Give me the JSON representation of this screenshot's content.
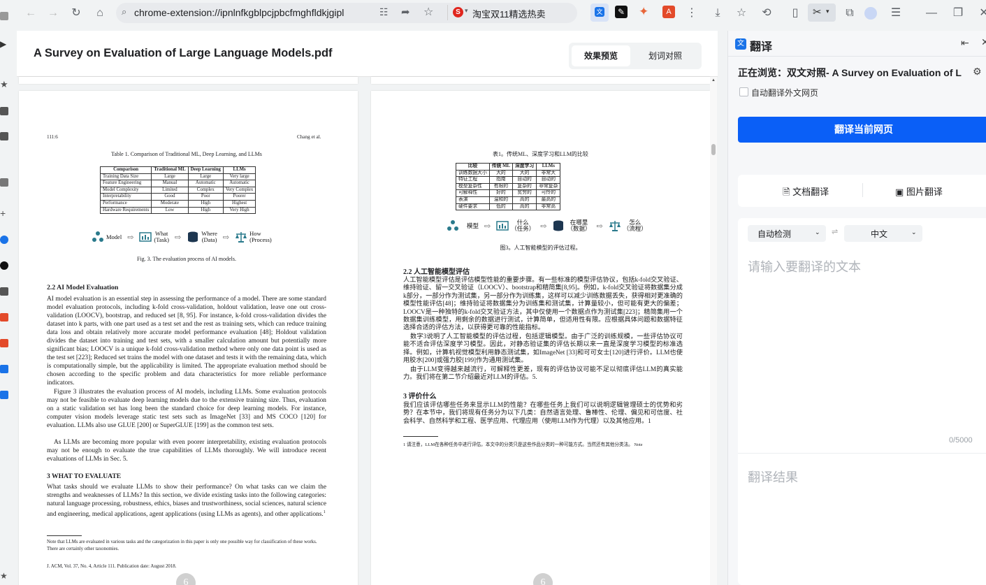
{
  "browser": {
    "url": "chrome-extension://ipnlnfkgblpcjpbcfmghfldkjgipl",
    "bookmark_text": "淘宝双11精选热卖",
    "bookmark_badge": "S"
  },
  "viewer": {
    "title": "A Survey on Evaluation of Large Language Models.pdf",
    "modes": [
      "效果预览",
      "划词对照"
    ],
    "active_mode": "效果预览"
  },
  "page_en": {
    "running_left": "111:6",
    "running_right": "Chang et al.",
    "table_caption": "Table 1.  Comparison of Traditional ML, Deep Learning, and LLMs",
    "table_headers": [
      "Comparison",
      "Traditional ML",
      "Deep Learning",
      "LLMs"
    ],
    "table_rows": [
      [
        "Training Data Size",
        "Large",
        "Large",
        "Very large"
      ],
      [
        "Feature Engineering",
        "Manual",
        "Automatic",
        "Automatic"
      ],
      [
        "Model Complexity",
        "Limited",
        "Complex",
        "Very Complex"
      ],
      [
        "Interpretability",
        "Good",
        "Poor",
        "Poorer"
      ],
      [
        "Performance",
        "Moderate",
        "High",
        "Highest"
      ],
      [
        "Hardware Requirements",
        "Low",
        "High",
        "Very High"
      ]
    ],
    "flow": {
      "model": "Model",
      "what": "What",
      "what_sub": "(Task)",
      "where": "Where",
      "where_sub": "(Data)",
      "how": "How",
      "how_sub": "(Process)"
    },
    "fig_caption": "Fig. 3.  The evaluation process of AI models.",
    "sec22_title": "2.2    AI Model Evaluation",
    "sec22_p1": "AI model evaluation is an essential step in assessing the performance of a model. There are some standard model evaluation protocols, including k-fold cross-validation, holdout validation, leave one out cross-validation (LOOCV), bootstrap, and reduced set [8, 95]. For instance, k-fold cross-validation divides the dataset into k parts, with one part used as a test set and the rest as training sets, which can reduce training data loss and obtain relatively more accurate model performance evaluation [48]; Holdout validation divides the dataset into training and test sets, with a smaller calculation amount but potentially more significant bias; LOOCV is a unique k-fold cross-validation method where only one data point is used as the test set [223]; Reduced set trains the model with one dataset and tests it with the remaining data, which is computationally simple, but the applicability is limited. The appropriate evaluation method should be chosen according to the specific problem and data characteristics for more reliable performance indicators.",
    "sec22_p2": "Figure 3 illustrates the evaluation process of AI models, including LLMs. Some evaluation protocols may not be feasible to evaluate deep learning models due to the extensive training size. Thus, evaluation on a static validation set has long been the standard choice for deep learning models. For instance, computer vision models leverage static test sets such as ImageNet [33] and MS COCO [120] for evaluation. LLMs also use GLUE [200] or SuperGLUE [199] as the common test sets.",
    "sec22_p3": "As LLMs are becoming more popular with even poorer interpretability, existing evaluation protocols may not be enough to evaluate the true capabilities of LLMs thoroughly. We will introduce recent evaluations of LLMs in Sec. 5.",
    "sec3_title": "3    WHAT TO EVALUATE",
    "sec3_p": "What tasks should we evaluate LLMs to show their performance? On what tasks can we claim the strengths and weaknesses of LLMs? In this section, we divide existing tasks into the following categories: natural language processing, robustness, ethics, biases and trustworthiness, social sciences, natural science and engineering, medical applications, agent applications (using LLMs as agents), and other applications.",
    "footnote_mark": "1",
    "footnote": "Note that LLMs are evaluated in various tasks and the categorization in this paper is only one possible way for classification of these works. There are certainly other taxonomies.",
    "journal": "J. ACM, Vol. 37, No. 4, Article 111. Publication date: August 2018.",
    "page_number": "6"
  },
  "page_zh": {
    "table_caption": "表1。传统ML、深度学习和LLM的比较",
    "table_headers": [
      "比较",
      "传统 ML",
      "深度学习",
      "LLMs"
    ],
    "table_rows": [
      [
        "训练数据大小",
        "大的",
        "大的",
        "非常大"
      ],
      [
        "特征工程",
        "指南",
        "自动的",
        "自动的"
      ],
      [
        "模型复杂性",
        "有限的",
        "复杂的",
        "非常复杂"
      ],
      [
        "可解释性",
        "好的",
        "贫穷的",
        "可怜的"
      ],
      [
        "表演",
        "温和的",
        "高的",
        "最高的"
      ],
      [
        "硬件要求",
        "低的",
        "高的",
        "非常高"
      ]
    ],
    "flow": {
      "model": "模型",
      "what": "什么",
      "what_sub": "（任务）",
      "where": "在哪里",
      "where_sub": "（数据）",
      "how": "怎么",
      "how_sub": "（流程）"
    },
    "fig_caption": "图3。人工智能模型的评估过程。",
    "sec22_title": "2.2    人工智能模型评估",
    "sec22_p1": "人工智能模型评估是评估模型性能的重要步骤。有一些标准的模型评估协议，包括k-fold交叉验证、维持验证、留一交叉验证（LOOCV）、bootstrap和精简集[8,95]。例如，k-fold交叉验证将数据集分成k部分，一部分作为测试集，另一部分作为训练集，这样可以减少训练数据丢失，获得相对更准确的模型性能评估[48]；维持验证将数据集分为训练集和测试集，计算量较小，但可能有更大的偏差；LOOCV是一种独特的k-fold交叉验证方法，其中仅使用一个数据点作为测试集[223]；精简集用一个数据集训练模型，用剩余的数据进行测试，计算简单，但适用性有限。应根据具体问题和数据特征选择合适的评估方法，以获得更可靠的性能指标。",
    "sec22_p2": "数字3说明了人工智能模型的评估过程，包括逻辑模型。由于广泛的训练规模，一些评估协议可能不适合评估深度学习模型。因此，对静态验证集的评估长期以来一直是深度学习模型的标准选择。例如，计算机视觉模型利用静态测试集，如ImageNet [33]和可可女士[120]进行评价。LLM也使用胶水[200]或强力胶[199]作为通用测试集。",
    "sec22_p3": "由于LLM变得越来越流行，可解释性更差，现有的评估协议可能不足以彻底评估LLM的真实能力。我们将在第二节介绍最近对LLM的评估。5.",
    "sec3_title": "3    评价什么",
    "sec3_p": "我们应该评估哪些任务来显示LLM的性能？在哪些任务上我们可以说明逻辑管理硕士的优势和劣势？在本节中，我们将现有任务分为以下几类：自然语言处理、鲁棒性、伦理、偏见和可信度、社会科学、自然科学和工程、医学应用、代理应用（使用LLM作为代理）以及其他应用。1",
    "footnote": "1 请注意，LLM在各种任务中进行评估，本文中的分类只是这些作品分类的一种可能方式。当然还有其他分类法。",
    "footnote_tail": "Note",
    "page_number": "6"
  },
  "panel": {
    "title": "翻译",
    "browsing": "正在浏览：双文对照- A Survey on Evaluation of L...",
    "auto_translate": "自动翻译外文网页",
    "translate_button": "翻译当前网页",
    "tab_doc": "文档翻译",
    "tab_image": "图片翻译",
    "source_lang": "自动检测",
    "target_lang": "中文",
    "input_placeholder": "请输入要翻译的文本",
    "counter": "0/5000",
    "result_placeholder": "翻译结果"
  },
  "colors": {
    "accent": "#0a5ff7",
    "flow_icon": "#2a7a8c"
  }
}
